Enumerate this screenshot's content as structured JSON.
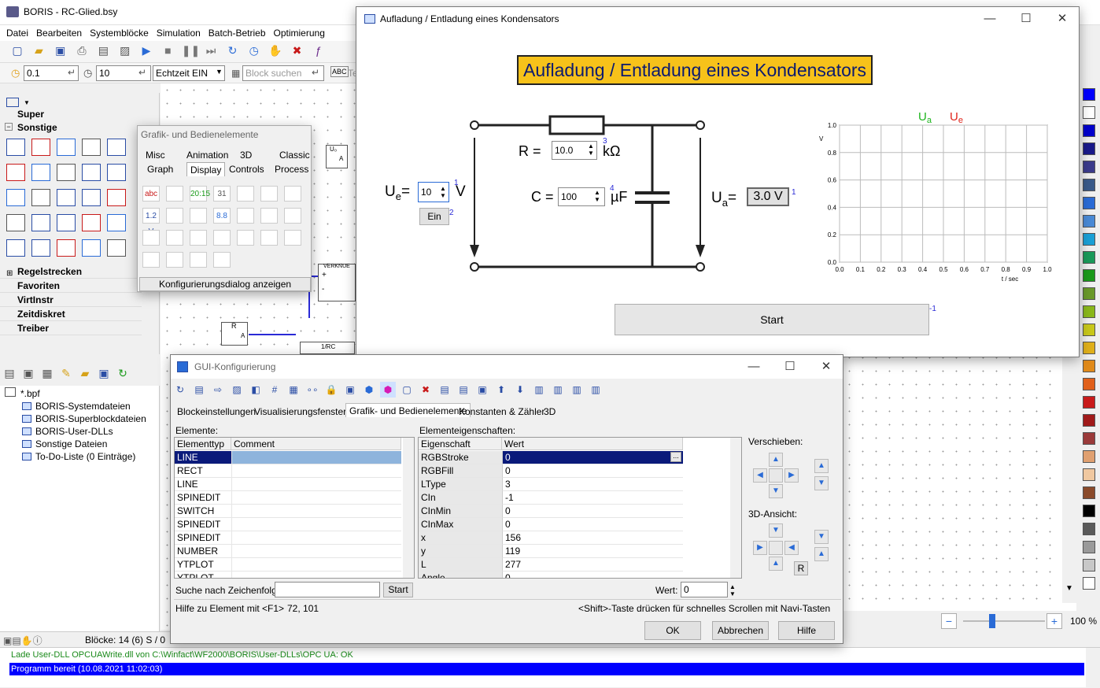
{
  "app": {
    "title": "BORIS - RC-Glied.bsy",
    "menu": [
      "Datei",
      "Bearbeiten",
      "Systemblöcke",
      "Simulation",
      "Batch-Betrieb",
      "Optimierung"
    ],
    "step_value": "0.1",
    "end_value": "10",
    "realtime_label": "Echtzeit EIN",
    "block_search_placeholder": "Block suchen",
    "block_search_trunc": "Te"
  },
  "sidebar": {
    "super_label": "Super",
    "sonstige_label": "Sonstige",
    "sections": [
      "Regelstrecken",
      "Favoriten",
      "VirtInstr",
      "Zeitdiskret",
      "Treiber"
    ]
  },
  "palette_popup": {
    "title": "Grafik- und Bedienelemente",
    "tabs_row1": [
      "Misc",
      "Animation",
      "3D",
      "Classic"
    ],
    "tabs_row2": [
      "Graph",
      "Display",
      "Controls",
      "Process"
    ],
    "icon_labels": [
      "abc",
      "1.2 V",
      "20:15",
      "31",
      "8.8"
    ],
    "config_button": "Konfigurierungsdialog anzeigen"
  },
  "canvas": {
    "block_labels": [
      "U₀",
      "A",
      "VERKNUE",
      "R",
      "A",
      "1/RC",
      "+",
      "-"
    ]
  },
  "project_tree": {
    "root": "*.bpf",
    "items": [
      "BORIS-Systemdateien",
      "BORIS-Superblockdateien",
      "BORIS-User-DLLs",
      "Sonstige Dateien",
      "To-Do-Liste (0 Einträge)"
    ]
  },
  "status": {
    "blocks": "Blöcke: 14 (6) S / 0 T",
    "log1": "Lade User-DLL OPCUAWrite.dll von C:\\Winfact\\WF2000\\BORIS\\User-DLLs\\OPC UA: OK",
    "log2": "Programm bereit   (10.08.2021 11:02:03)"
  },
  "zoom": {
    "value": "100 %",
    "minus": "−",
    "plus": "+"
  },
  "viz_window": {
    "title": "Aufladung / Entladung eines Kondensators",
    "heading": "Aufladung / Entladung eines Kondensators",
    "r_label": "R =",
    "r_value": "10.0",
    "r_unit": "kΩ",
    "r_index": "3",
    "c_label": "C =",
    "c_value": "100",
    "c_unit": "µF",
    "c_index": "4",
    "ue_label": "U",
    "ue_sub": "e",
    "ue_eq": "=",
    "ue_value": "10",
    "ue_unit": "V",
    "ue_index": "1",
    "ein_button": "Ein",
    "ein_index": "2",
    "ua_label": "U",
    "ua_sub": "a",
    "ua_eq": "=",
    "ua_value": "3.0 V",
    "ua_index": "1",
    "start_button": "Start",
    "start_index": "-1",
    "colors": {
      "heading_bg": "#f7c21a",
      "ua_color": "#1db51d",
      "ue_color": "#e0241b"
    }
  },
  "chart_data": {
    "type": "line",
    "title": "",
    "xlabel": "t / sec",
    "ylabel": "V",
    "xlim": [
      0,
      1.0
    ],
    "ylim": [
      0,
      1.0
    ],
    "x_ticks": [
      "0.0",
      "0.1",
      "0.2",
      "0.3",
      "0.4",
      "0.5",
      "0.6",
      "0.7",
      "0.8",
      "0.9",
      "1.0"
    ],
    "y_ticks": [
      "0.0",
      "0.2",
      "0.4",
      "0.6",
      "0.8",
      "1.0"
    ],
    "legend": [
      "U",
      "U"
    ],
    "legend_subs": [
      "a",
      "e"
    ],
    "legend_position": "top",
    "grid": true,
    "series": []
  },
  "gui_dialog": {
    "title": "GUI-Konfigurierung",
    "tabs": [
      "Blockeinstellungen",
      "Visualisierungsfenster",
      "Grafik- und Bedienelemente",
      "Konstanten & Zähler",
      "3D"
    ],
    "elements_label": "Elemente:",
    "elements_headers": [
      "Elementtyp",
      "Comment"
    ],
    "elements": [
      "LINE",
      "RECT",
      "LINE",
      "SPINEDIT",
      "SWITCH",
      "SPINEDIT",
      "SPINEDIT",
      "NUMBER",
      "YTPLOT",
      "YTPLOT"
    ],
    "props_label": "Elementeigenschaften:",
    "props_headers": [
      "Eigenschaft",
      "Wert"
    ],
    "props": [
      [
        "RGBStroke",
        "0"
      ],
      [
        "RGBFill",
        "0"
      ],
      [
        "LType",
        "3"
      ],
      [
        "CIn",
        "-1"
      ],
      [
        "CInMin",
        "0"
      ],
      [
        "CInMax",
        "0"
      ],
      [
        "x",
        "156"
      ],
      [
        "y",
        "119"
      ],
      [
        "L",
        "277"
      ],
      [
        "Angle",
        "0"
      ]
    ],
    "shift_label": "Verschieben:",
    "view3d_label": "3D-Ansicht:",
    "reset_label": "R",
    "search_label": "Suche nach Zeichenfolge",
    "search_button": "Start",
    "wert_label": "Wert:",
    "wert_value": "0",
    "help_text": "Hilfe zu Element mit <F1>",
    "coords": "72, 101",
    "shift_hint": "<Shift>-Taste drücken für schnelles Scrollen mit Navi-Tasten",
    "ok": "OK",
    "cancel": "Abbrechen",
    "help": "Hilfe",
    "ellipsis": "..."
  },
  "palette_colors": [
    "#0000ff",
    "#ffffff",
    "#0000cc",
    "#1a1a8a",
    "#3b3b8c",
    "#3a5a8a",
    "#2a6bd6",
    "#4a8ad6",
    "#1aa0d6",
    "#1a9a5a",
    "#1a9a1a",
    "#6a9a2a",
    "#8ab81a",
    "#c8c81a",
    "#e0b01a",
    "#e08a1a",
    "#e0601a",
    "#c81a1a",
    "#a01a1a",
    "#9a3a3a",
    "#e0a070",
    "#f0c8a0",
    "#8a4a2a",
    "#000000",
    "#5a5a5a",
    "#9a9a9a",
    "#c8c8c8",
    "#ffffff"
  ]
}
